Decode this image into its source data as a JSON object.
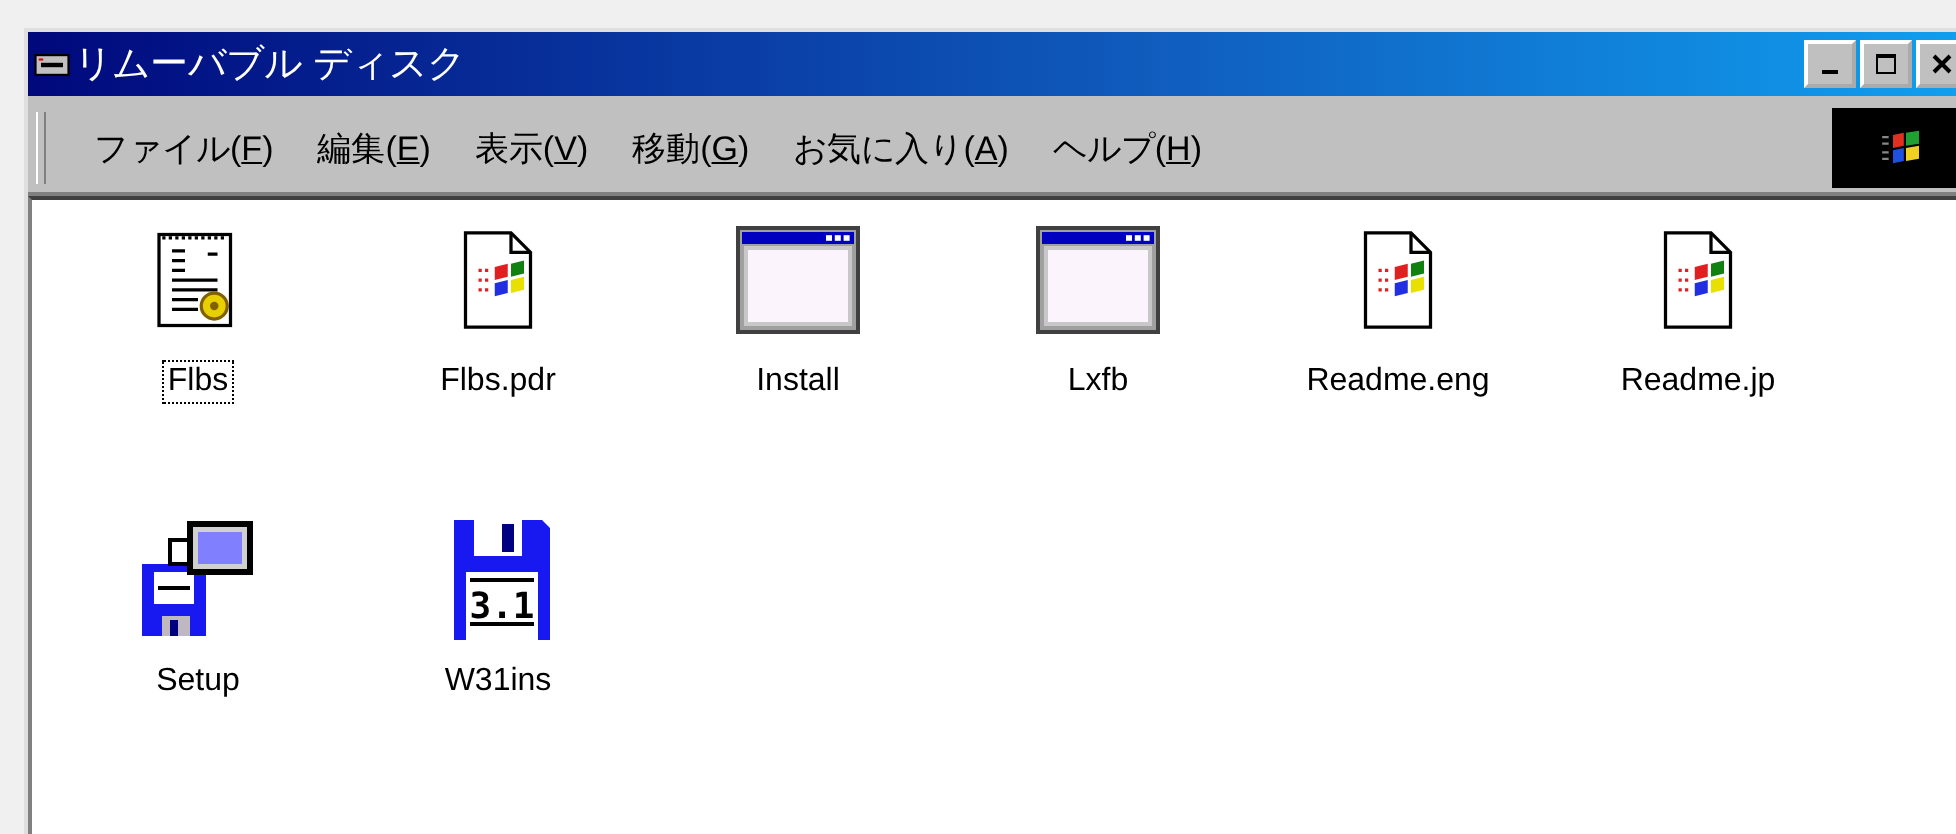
{
  "window": {
    "title": "リムーバブル ディスク"
  },
  "menu": [
    {
      "before": "ファイル(",
      "key": "F",
      "after": ")"
    },
    {
      "before": "編集(",
      "key": "E",
      "after": ")"
    },
    {
      "before": "表示(",
      "key": "V",
      "after": ")"
    },
    {
      "before": "移動(",
      "key": "G",
      "after": ")"
    },
    {
      "before": "お気に入り(",
      "key": "A",
      "after": ")"
    },
    {
      "before": "ヘルプ(",
      "key": "H",
      "after": ")"
    }
  ],
  "rows": [
    [
      {
        "name": "Flbs",
        "kind": "config",
        "focused": true
      },
      {
        "name": "Flbs.pdr",
        "kind": "doc",
        "focused": false
      },
      {
        "name": "Install",
        "kind": "app",
        "focused": false
      },
      {
        "name": "Lxfb",
        "kind": "app",
        "focused": false
      },
      {
        "name": "Readme.eng",
        "kind": "doc",
        "focused": false
      },
      {
        "name": "Readme.jp",
        "kind": "doc",
        "focused": false
      }
    ],
    [
      {
        "name": "Setup",
        "kind": "setup",
        "focused": false
      },
      {
        "name": "W31ins",
        "kind": "floppy",
        "focused": false,
        "badge": "3.1"
      }
    ]
  ]
}
